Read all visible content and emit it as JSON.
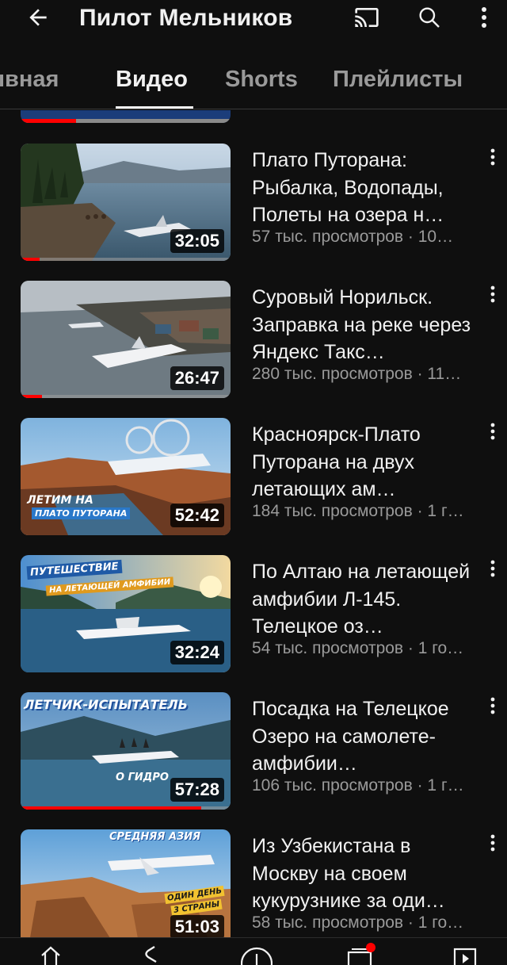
{
  "header": {
    "title": "Пилот Мельников",
    "icons": {
      "back": "arrow-left-icon",
      "cast": "cast-icon",
      "search": "search-icon",
      "more": "more-vertical-icon"
    }
  },
  "tabs": [
    {
      "label": "ıвная"
    },
    {
      "label": "Видео",
      "active": true
    },
    {
      "label": "Shorts"
    },
    {
      "label": "Плейлисты"
    }
  ],
  "videos": [
    {
      "title": "Плато Путорана: Рыбалка, Водопады, Полеты на озера н…",
      "meta": "57 тыс. просмотров · 10…",
      "duration": "32:05",
      "progress": 0.09
    },
    {
      "title": "Суровый Норильск. Заправка на реке через Яндекс Такс…",
      "meta": "280 тыс. просмотров · 11…",
      "duration": "26:47",
      "progress": 0.1
    },
    {
      "title": "Красноярск-Плато Путорана на двух летающих ам…",
      "meta": "184 тыс. просмотров · 1 г…",
      "duration": "52:42",
      "progress": 0,
      "overlay": [
        "ЛЕТИМ НА",
        "ПЛАТО ПУТОРАНА"
      ]
    },
    {
      "title": "По Алтаю на летающей амфибии Л-145. Телецкое оз…",
      "meta": "54 тыс. просмотров · 1 го…",
      "duration": "32:24",
      "progress": 0,
      "overlay": [
        "ПУТЕШЕСТВИЕ",
        "НА ЛЕТАЮЩЕЙ АМФИБИИ"
      ]
    },
    {
      "title": "Посадка на Телецкое Озеро на самолете-амфибии…",
      "meta": "106 тыс. просмотров · 1 г…",
      "duration": "57:28",
      "progress": 0.86,
      "overlay": [
        "ЛЕТЧИК-ИСПЫТАТЕЛЬ",
        "О ГИДРО"
      ]
    },
    {
      "title": "Из Узбекистана в Москву на своем кукурузнике за оди…",
      "meta": "58 тыс. просмотров · 1 го…",
      "duration": "51:03",
      "progress": 0,
      "overlay": [
        "СРЕДНЯЯ АЗИЯ",
        "ОДИН ДЕНЬ",
        "3 СТРАНЫ"
      ]
    }
  ],
  "bottom_nav": [
    "home-icon",
    "shorts-icon",
    "create-icon",
    "subscriptions-icon",
    "library-icon"
  ],
  "colors": {
    "background": "#0f0f0f",
    "accent": "#ff0000",
    "text": "#f1f1f1",
    "secondary": "#9a9a9a"
  }
}
